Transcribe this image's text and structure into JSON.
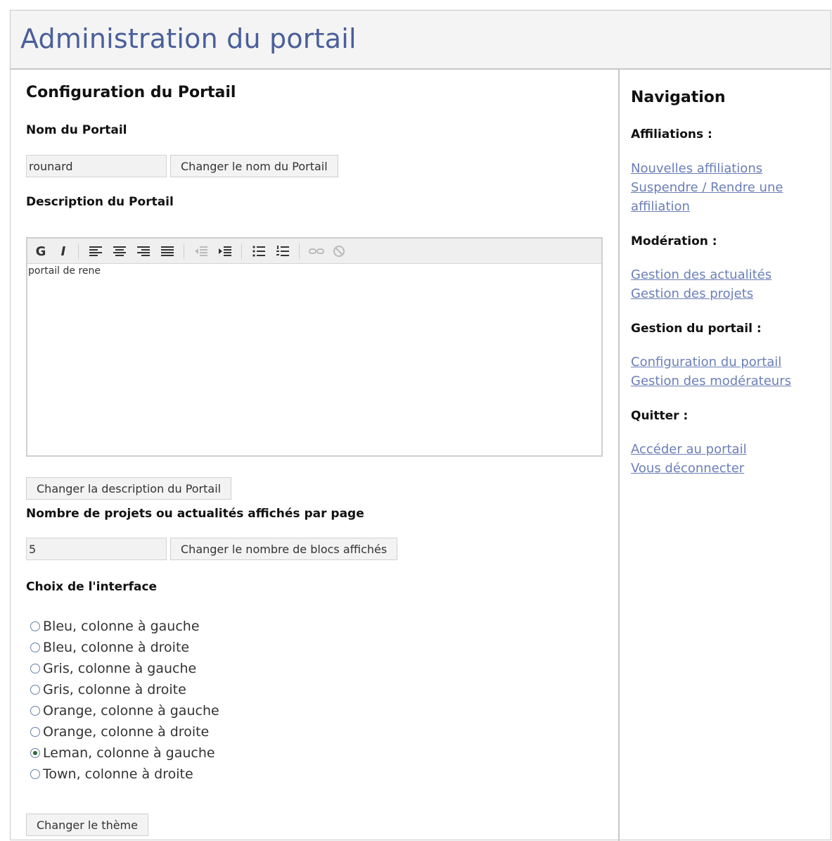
{
  "header": {
    "title": "Administration du portail"
  },
  "main": {
    "title": "Configuration du Portail",
    "name_section": {
      "label": "Nom du Portail",
      "value": "rounard",
      "button": "Changer le nom du Portail"
    },
    "description_section": {
      "label": "Description du Portail",
      "content": "portail de rene",
      "button": "Changer la description du Portail",
      "toolbar": [
        "bold-icon",
        "italic-icon",
        "align-left-icon",
        "align-center-icon",
        "align-right-icon",
        "align-justify-icon",
        "outdent-icon",
        "indent-icon",
        "bullet-list-icon",
        "numbered-list-icon",
        "link-icon",
        "unlink-icon"
      ]
    },
    "blocks_section": {
      "label": "Nombre de projets ou actualités affichés par page",
      "value": "5",
      "button": "Changer le nombre de blocs affichés"
    },
    "theme_section": {
      "label": "Choix de l'interface",
      "options": [
        {
          "label": "Bleu, colonne à gauche",
          "checked": false
        },
        {
          "label": "Bleu, colonne à droite",
          "checked": false
        },
        {
          "label": "Gris, colonne à gauche",
          "checked": false
        },
        {
          "label": "Gris, colonne à droite",
          "checked": false
        },
        {
          "label": "Orange, colonne à gauche",
          "checked": false
        },
        {
          "label": "Orange, colonne à droite",
          "checked": false
        },
        {
          "label": "Leman, colonne à gauche",
          "checked": true
        },
        {
          "label": "Town, colonne à droite",
          "checked": false
        }
      ],
      "button": "Changer le thème"
    }
  },
  "sidebar": {
    "title": "Navigation",
    "groups": [
      {
        "heading": "Affiliations :",
        "links": [
          "Nouvelles affiliations",
          "Suspendre / Rendre une",
          "affiliation"
        ]
      },
      {
        "heading": "Modération :",
        "links": [
          "Gestion des actualités",
          "Gestion des projets"
        ]
      },
      {
        "heading": "Gestion du portail :",
        "links": [
          "Configuration du portail",
          "Gestion des modérateurs"
        ]
      },
      {
        "heading": "Quitter :",
        "links": [
          "Accéder au portail",
          "Vous déconnecter"
        ]
      }
    ]
  },
  "colors": {
    "title": "#4a5f9a",
    "link": "#6b7fb8",
    "header_bg": "#f4f4f4",
    "border": "#c6c6c6"
  }
}
